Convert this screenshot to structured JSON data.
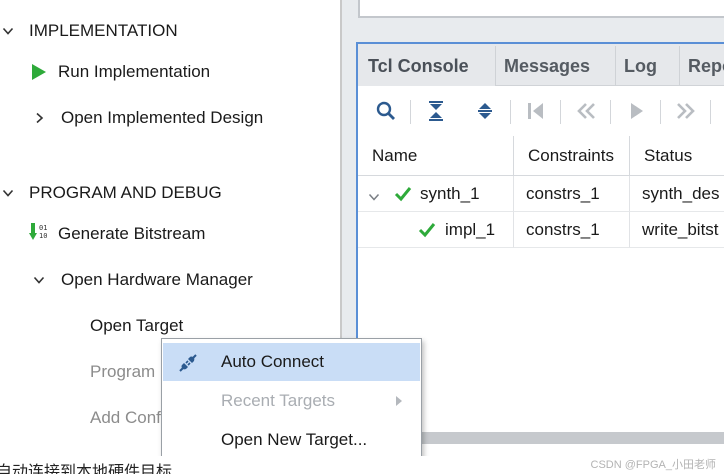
{
  "flow_navigator": {
    "implementation": {
      "header": "IMPLEMENTATION",
      "run": "Run Implementation",
      "open_design": "Open Implemented Design"
    },
    "program_debug": {
      "header": "PROGRAM AND DEBUG",
      "generate_bitstream": "Generate Bitstream",
      "open_hw_manager": "Open Hardware Manager",
      "open_target": "Open Target",
      "program_device": "Program",
      "add_config": "Add Conf"
    }
  },
  "console_panel": {
    "tabs": [
      "Tcl Console",
      "Messages",
      "Log",
      "Repo"
    ],
    "columns": [
      "Name",
      "Constraints",
      "Status"
    ],
    "rows": [
      {
        "name": "synth_1",
        "constraints": "constrs_1",
        "status": "synth_des"
      },
      {
        "name": "impl_1",
        "constraints": "constrs_1",
        "status": "write_bitst"
      }
    ]
  },
  "context_menu": {
    "items": [
      {
        "label": "Auto Connect",
        "highlighted": true
      },
      {
        "label": "Recent Targets",
        "disabled": true
      },
      {
        "label": "Open New Target..."
      }
    ]
  },
  "caption": "自动连接到本地硬件目标",
  "watermark": "CSDN @FPGA_小田老师",
  "colors": {
    "accent_blue": "#5a8fd6",
    "menu_highlight": "#c9ddf6",
    "run_green": "#2eaa3a",
    "check_green": "#2eaa3a"
  }
}
